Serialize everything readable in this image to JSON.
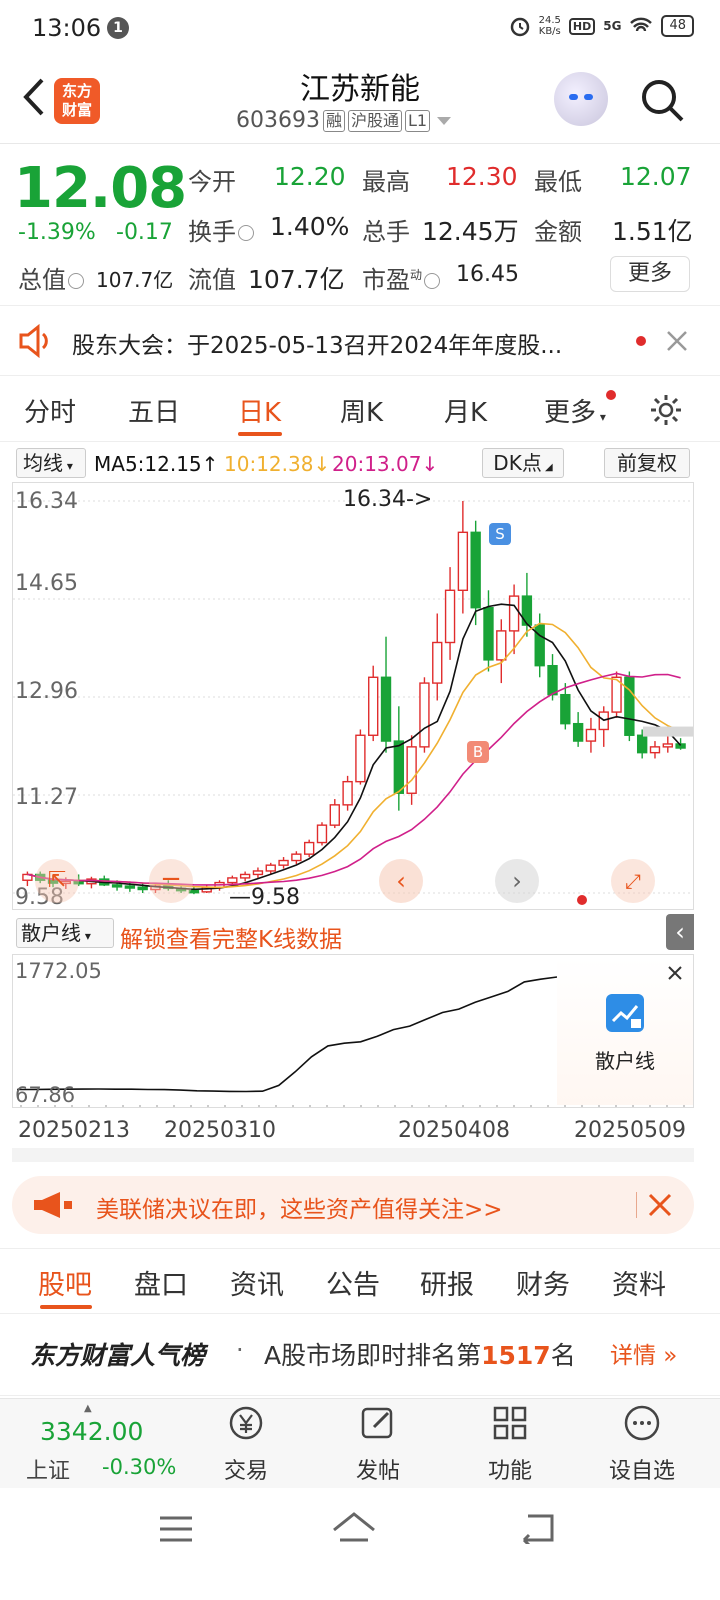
{
  "status": {
    "time": "13:06",
    "notif": "1",
    "net_speed": "24.5",
    "net_unit": "KB/s",
    "hd": "HD",
    "signal": "5G",
    "battery": "48"
  },
  "header": {
    "name": "江苏新能",
    "code": "603693",
    "tags": [
      "融",
      "沪股通",
      "L1"
    ],
    "logo_text": "东方\n财富"
  },
  "quote": {
    "price": "12.08",
    "pct": "-1.39%",
    "change": "-0.17",
    "open_label": "今开",
    "open": "12.20",
    "high_label": "最高",
    "high": "12.30",
    "low_label": "最低",
    "low": "12.07",
    "turnover_label": "换手",
    "turnover": "1.40%",
    "volume_label": "总手",
    "volume": "12.45万",
    "amount_label": "金额",
    "amount": "1.51亿",
    "mcap_label": "总值",
    "mcap": "107.7亿",
    "float_label": "流值",
    "float": "107.7亿",
    "pe_label": "市盈",
    "pe_sup": "动",
    "pe": "16.45",
    "more": "更多"
  },
  "notice": {
    "text": "股东大会：于2025-05-13召开2024年年度股..."
  },
  "tabs": [
    "分时",
    "五日",
    "日K",
    "周K",
    "月K",
    "更多"
  ],
  "ma": {
    "selector": "均线",
    "ma5": "MA5:12.15",
    "ma10": "10:12.38",
    "ma20": "20:13.07",
    "dk": "DK点",
    "fq": "前复权"
  },
  "chart_data": [
    {
      "type": "candlestick",
      "y_ticks": [
        "16.34",
        "14.65",
        "12.96",
        "11.27",
        "9.58"
      ],
      "ylim": [
        9.58,
        16.34
      ],
      "max_label": "16.34->",
      "min_label": "9.58",
      "signals": [
        "S",
        "B"
      ],
      "series": [
        {
          "name": "MA5",
          "color": "#111111"
        },
        {
          "name": "MA10",
          "color": "#f0b030"
        },
        {
          "name": "MA20",
          "color": "#d0208a"
        }
      ],
      "candles": [
        [
          9.8,
          9.95,
          9.7,
          9.9
        ],
        [
          9.9,
          9.95,
          9.75,
          9.8
        ],
        [
          9.8,
          9.88,
          9.68,
          9.75
        ],
        [
          9.75,
          9.85,
          9.65,
          9.78
        ],
        [
          9.78,
          9.9,
          9.7,
          9.74
        ],
        [
          9.74,
          9.86,
          9.66,
          9.82
        ],
        [
          9.82,
          9.88,
          9.7,
          9.72
        ],
        [
          9.72,
          9.8,
          9.62,
          9.7
        ],
        [
          9.7,
          9.78,
          9.6,
          9.68
        ],
        [
          9.68,
          9.76,
          9.58,
          9.64
        ],
        [
          9.64,
          9.74,
          9.58,
          9.7
        ],
        [
          9.7,
          9.8,
          9.62,
          9.66
        ],
        [
          9.66,
          9.72,
          9.58,
          9.62
        ],
        [
          9.62,
          9.7,
          9.56,
          9.6
        ],
        [
          9.6,
          9.72,
          9.58,
          9.68
        ],
        [
          9.68,
          9.8,
          9.62,
          9.76
        ],
        [
          9.76,
          9.88,
          9.7,
          9.84
        ],
        [
          9.84,
          9.95,
          9.78,
          9.9
        ],
        [
          9.9,
          10.02,
          9.84,
          9.96
        ],
        [
          9.96,
          10.1,
          9.9,
          10.06
        ],
        [
          10.06,
          10.2,
          10.0,
          10.14
        ],
        [
          10.14,
          10.3,
          10.08,
          10.25
        ],
        [
          10.25,
          10.5,
          10.2,
          10.45
        ],
        [
          10.45,
          10.8,
          10.4,
          10.75
        ],
        [
          10.75,
          11.2,
          10.7,
          11.1
        ],
        [
          11.1,
          11.6,
          11.0,
          11.5
        ],
        [
          11.5,
          12.4,
          11.45,
          12.3
        ],
        [
          12.3,
          13.5,
          12.2,
          13.3
        ],
        [
          13.3,
          14.0,
          12.0,
          12.2
        ],
        [
          12.2,
          12.8,
          11.0,
          11.3
        ],
        [
          11.3,
          12.3,
          11.1,
          12.1
        ],
        [
          12.1,
          13.3,
          12.0,
          13.2
        ],
        [
          13.2,
          14.4,
          12.9,
          13.9
        ],
        [
          13.9,
          15.2,
          13.6,
          14.8
        ],
        [
          14.8,
          16.34,
          14.4,
          15.8
        ],
        [
          15.8,
          16.0,
          14.2,
          14.5
        ],
        [
          14.5,
          14.8,
          13.4,
          13.6
        ],
        [
          13.6,
          14.3,
          13.2,
          14.1
        ],
        [
          14.1,
          14.9,
          13.7,
          14.7
        ],
        [
          14.7,
          15.1,
          14.0,
          14.2
        ],
        [
          14.2,
          14.4,
          13.3,
          13.5
        ],
        [
          13.5,
          13.7,
          12.9,
          13.0
        ],
        [
          13.0,
          13.2,
          12.4,
          12.5
        ],
        [
          12.5,
          12.7,
          12.1,
          12.2
        ],
        [
          12.2,
          12.6,
          12.0,
          12.4
        ],
        [
          12.4,
          12.8,
          12.1,
          12.7
        ],
        [
          12.7,
          13.4,
          12.6,
          13.3
        ],
        [
          13.3,
          13.4,
          12.2,
          12.3
        ],
        [
          12.3,
          12.4,
          11.9,
          12.0
        ],
        [
          12.0,
          12.2,
          11.9,
          12.1
        ],
        [
          12.1,
          12.3,
          12.0,
          12.15
        ],
        [
          12.15,
          12.25,
          12.05,
          12.08
        ]
      ]
    },
    {
      "type": "line",
      "name": "散户线",
      "ylim": [
        67.86,
        1772.05
      ],
      "y_ticks": [
        "1772.05",
        "67.86"
      ],
      "values": [
        120,
        120,
        122,
        124,
        125,
        126,
        124,
        123,
        120,
        118,
        110,
        100,
        96,
        92,
        90,
        95,
        180,
        380,
        600,
        760,
        800,
        820,
        900,
        1000,
        1050,
        1150,
        1250,
        1300,
        1400,
        1480,
        1560,
        1700,
        1740,
        1772
      ]
    }
  ],
  "indicator": {
    "selector": "散户线",
    "unlock": "解锁查看完整K线数据",
    "card_label": "散户线"
  },
  "dates": [
    "20250213",
    "20250310",
    "20250408",
    "20250509"
  ],
  "banner": {
    "text": "美联储决议在即，这些资产值得关注>>"
  },
  "subtabs": [
    "股吧",
    "盘口",
    "资讯",
    "公告",
    "研报",
    "财务",
    "资料"
  ],
  "rank": {
    "brand": "东方财富人气榜",
    "dot": "·",
    "prefix": "A股市场即时排名第",
    "num": "1517",
    "suffix": "名",
    "detail": "详情"
  },
  "nav": {
    "index_value": "3342.00",
    "index_name": "上证",
    "index_pct": "-0.30%",
    "trade": "交易",
    "post": "发帖",
    "func": "功能",
    "fav": "设自选"
  }
}
